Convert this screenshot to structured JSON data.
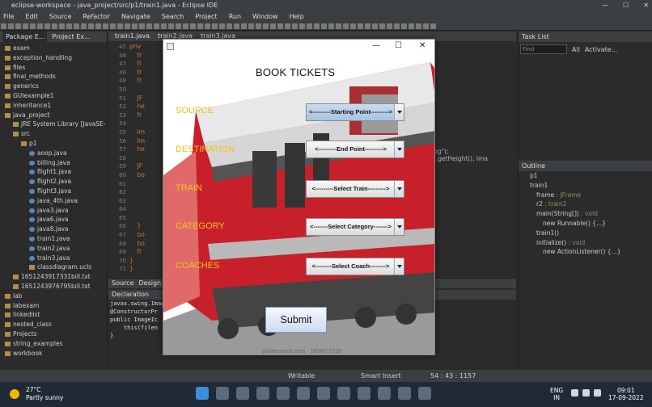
{
  "window": {
    "title": "eclipse-workspace - java_project/src/p1/train1.java - Eclipse IDE",
    "controls": [
      "—",
      "☐",
      "✕"
    ]
  },
  "menu": [
    "File",
    "Edit",
    "Source",
    "Refactor",
    "Navigate",
    "Search",
    "Project",
    "Run",
    "Window",
    "Help"
  ],
  "package_explorer": {
    "tabs": [
      "Package E...",
      "Project Ex..."
    ],
    "items": [
      {
        "label": "exam",
        "indent": 0
      },
      {
        "label": "exception_handling",
        "indent": 0
      },
      {
        "label": "files",
        "indent": 0
      },
      {
        "label": "final_methods",
        "indent": 0
      },
      {
        "label": "generics",
        "indent": 0
      },
      {
        "label": "GUIexample1",
        "indent": 0
      },
      {
        "label": "inheritance1",
        "indent": 0
      },
      {
        "label": "java_project",
        "indent": 0
      },
      {
        "label": "JRE System Library [JavaSE-",
        "indent": 1
      },
      {
        "label": "src",
        "indent": 1
      },
      {
        "label": "p1",
        "indent": 2
      },
      {
        "label": "aoop.java",
        "indent": 3
      },
      {
        "label": "billing.java",
        "indent": 3
      },
      {
        "label": "flight1.java",
        "indent": 3
      },
      {
        "label": "flight2.java",
        "indent": 3
      },
      {
        "label": "flight3.java",
        "indent": 3
      },
      {
        "label": "java_4th.java",
        "indent": 3
      },
      {
        "label": "java3.java",
        "indent": 3
      },
      {
        "label": "java6.java",
        "indent": 3
      },
      {
        "label": "java8.java",
        "indent": 3
      },
      {
        "label": "train1.java",
        "indent": 3
      },
      {
        "label": "train2.java",
        "indent": 3
      },
      {
        "label": "train3.java",
        "indent": 3
      },
      {
        "label": "classdiagram.ucls",
        "indent": 3
      },
      {
        "label": "1651243917331bill.txt",
        "indent": 1
      },
      {
        "label": "1651243976795bill.txt",
        "indent": 1
      },
      {
        "label": "lab",
        "indent": 0
      },
      {
        "label": "labexam",
        "indent": 0
      },
      {
        "label": "linkedlist",
        "indent": 0
      },
      {
        "label": "nested_class",
        "indent": 0
      },
      {
        "label": "Projects",
        "indent": 0
      },
      {
        "label": "string_examples",
        "indent": 0
      },
      {
        "label": "workbook",
        "indent": 0
      }
    ]
  },
  "editor": {
    "tabs": [
      "train1.java",
      "train2.java",
      "train3.java"
    ],
    "line_numbers": [
      "45",
      "46",
      "47",
      "48",
      "49",
      "50",
      "51",
      "52",
      "53",
      "54",
      "55",
      "56",
      "57",
      "58",
      "59",
      "60",
      "61",
      "62",
      "63",
      "64",
      "65",
      "66",
      "67",
      "68",
      "69",
      "70",
      "71"
    ],
    "code_lines": [
      "priv",
      "    fr",
      "    fr",
      "    fr",
      "    fr",
      "",
      "    JF",
      "    he",
      "    fr",
      "",
      "    Im",
      "    Im",
      "    he",
      "",
      "    JF",
      "    bo",
      "",
      "",
      "",
      "",
      "",
      "    }",
      "    bo",
      "    bo",
      "    fr",
      "}",
      "}"
    ],
    "code_right": [
      "jpg\");",
      "g.getHeight(), Ima"
    ],
    "bottom_tabs": [
      "Source",
      "Design"
    ]
  },
  "declaration": {
    "tab": "Declaration",
    "path": "javax.swing.ImageIcon",
    "lines": [
      "@ConstructorPr",
      "public ImageIc",
      "    this(filen",
      "}"
    ]
  },
  "task_list": {
    "tab": "Task List",
    "find_placeholder": "Find",
    "all": "All",
    "activate": "Activate..."
  },
  "outline": {
    "tab": "Outline",
    "items": [
      {
        "label": "p1",
        "type": ""
      },
      {
        "label": "train1",
        "type": ""
      },
      {
        "label": "frame",
        "type": ": JFrame"
      },
      {
        "label": "r2",
        "type": ": train2"
      },
      {
        "label": "main(String[])",
        "type": ": void"
      },
      {
        "label": "new Runnable() {...}",
        "type": ""
      },
      {
        "label": "train1()",
        "type": ""
      },
      {
        "label": "initialize()",
        "type": ": void"
      },
      {
        "label": "new ActionListener() {...}",
        "type": ""
      }
    ]
  },
  "statusbar": {
    "mode": "Writable",
    "insert": "Smart Insert",
    "position": "54 : 43 : 1157"
  },
  "taskbar": {
    "temp": "27°C",
    "weather": "Partly sunny",
    "lang1": "ENG",
    "lang2": "IN",
    "time": "09:01",
    "date": "17-09-2022"
  },
  "app": {
    "heading": "BOOK TICKETS",
    "fields": [
      {
        "label": "SOURCE",
        "combo": "<---------Starting Point--------->"
      },
      {
        "label": "DESTINATION",
        "combo": "<---------End Point--------->"
      },
      {
        "label": "TRAIN",
        "combo": "<---------Select Train--------->"
      },
      {
        "label": "CATEGORY",
        "combo": "<-------Select Category------->"
      },
      {
        "label": "COACHES",
        "combo": "<--------Select Coach-------->"
      }
    ],
    "submit": "Submit",
    "watermark": "shutterstock.com · 1804972720"
  }
}
